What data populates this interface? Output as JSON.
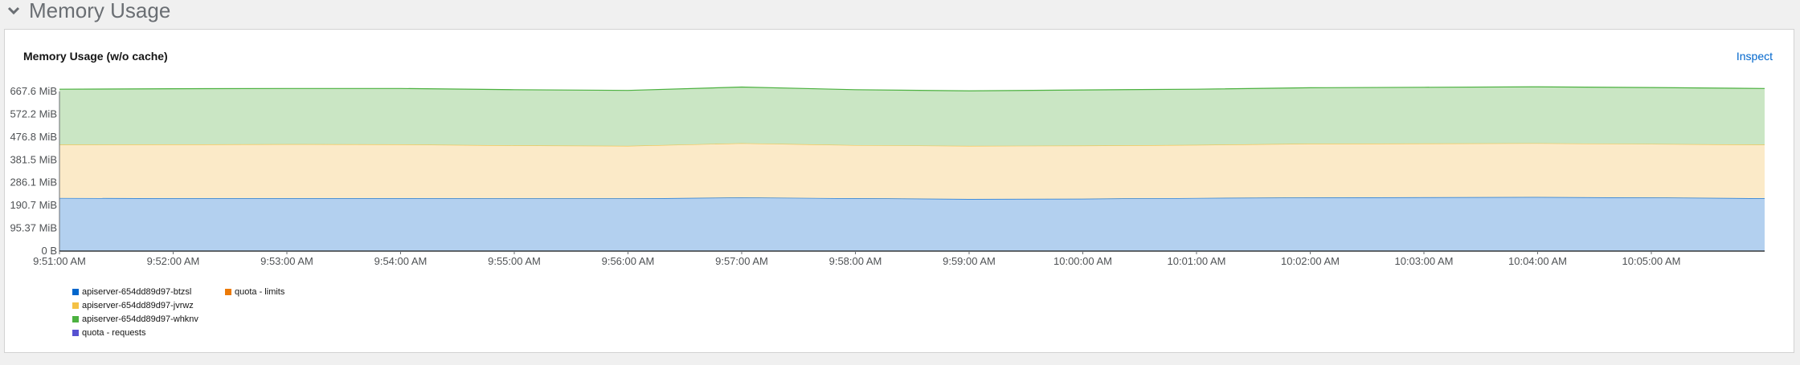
{
  "section": {
    "title": "Memory Usage"
  },
  "panel": {
    "title": "Memory Usage (w/o cache)",
    "inspect_label": "Inspect"
  },
  "colors": {
    "btzsl_line": "#06c",
    "btzsl_fill": "#b3d0ef",
    "jvrwz_line": "#f4c145",
    "jvrwz_fill": "#fbeac8",
    "whknv_line": "#4cb140",
    "whknv_fill": "#cae6c4",
    "limits": "#ec7a08",
    "requests": "#5752d1"
  },
  "chart_data": {
    "type": "area",
    "stacked": true,
    "title": "Memory Usage (w/o cache)",
    "y_unit": "MiB",
    "ylim": [
      0,
      667.6
    ],
    "y_ticks": [
      "0 B",
      "95.37 MiB",
      "190.7 MiB",
      "286.1 MiB",
      "381.5 MiB",
      "476.8 MiB",
      "572.2 MiB",
      "667.6 MiB"
    ],
    "y_tick_values": [
      0,
      95.37,
      190.7,
      286.1,
      381.5,
      476.8,
      572.2,
      667.6
    ],
    "x_ticks": [
      "9:51:00 AM",
      "9:52:00 AM",
      "9:53:00 AM",
      "9:54:00 AM",
      "9:55:00 AM",
      "9:56:00 AM",
      "9:57:00 AM",
      "9:58:00 AM",
      "9:59:00 AM",
      "10:00:00 AM",
      "10:01:00 AM",
      "10:02:00 AM",
      "10:03:00 AM",
      "10:04:00 AM",
      "10:05:00 AM"
    ],
    "x": [
      "9:51:00 AM",
      "9:52:00 AM",
      "9:53:00 AM",
      "9:54:00 AM",
      "9:55:00 AM",
      "9:56:00 AM",
      "9:57:00 AM",
      "9:58:00 AM",
      "9:59:00 AM",
      "10:00:00 AM",
      "10:01:00 AM",
      "10:02:00 AM",
      "10:03:00 AM",
      "10:04:00 AM",
      "10:05:00 AM",
      "10:06:00 AM"
    ],
    "series": [
      {
        "name": "apiserver-654dd89d97-btzsl",
        "values": [
          222,
          221,
          221,
          221,
          220,
          220,
          224,
          221,
          218,
          219,
          222,
          224,
          225,
          226,
          224,
          221
        ]
      },
      {
        "name": "apiserver-654dd89d97-jvrwz",
        "values": [
          223,
          225,
          226,
          225,
          222,
          220,
          227,
          222,
          222,
          222,
          222,
          225,
          225,
          225,
          224,
          224
        ]
      },
      {
        "name": "apiserver-654dd89d97-whknv",
        "values": [
          232,
          233,
          233,
          234,
          233,
          232,
          235,
          232,
          230,
          233,
          233,
          234,
          235,
          236,
          236,
          235
        ]
      },
      {
        "name": "quota - limits",
        "values": []
      },
      {
        "name": "quota - requests",
        "values": []
      }
    ],
    "legend": [
      {
        "label": "apiserver-654dd89d97-btzsl",
        "color": "#06c"
      },
      {
        "label": "quota - limits",
        "color": "#ec7a08"
      },
      {
        "label": "apiserver-654dd89d97-jvrwz",
        "color": "#f4c145"
      },
      {
        "label": "apiserver-654dd89d97-whknv",
        "color": "#4cb140"
      },
      {
        "label": "quota - requests",
        "color": "#5752d1"
      }
    ],
    "grid": true,
    "legend_position": "bottom-left"
  }
}
